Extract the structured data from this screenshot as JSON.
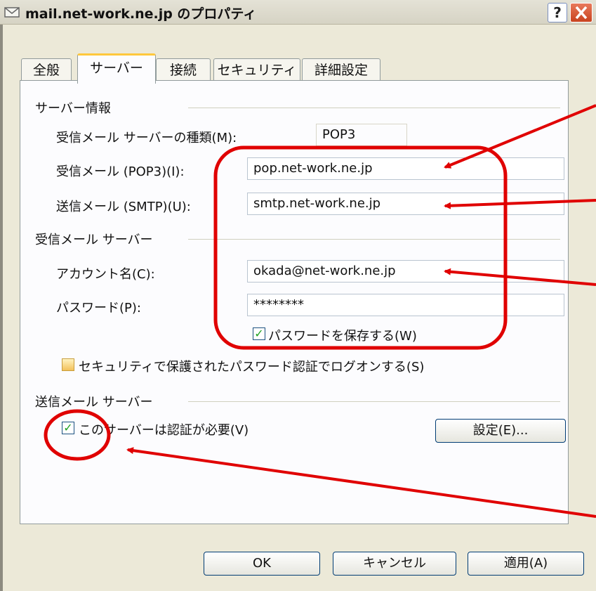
{
  "window": {
    "title": "mail.net-work.ne.jp のプロパティ",
    "help_label": "?",
    "close_label": "✕"
  },
  "tabs": [
    {
      "label": "全般"
    },
    {
      "label": "サーバー"
    },
    {
      "label": "接続"
    },
    {
      "label": "セキュリティ"
    },
    {
      "label": "詳細設定"
    }
  ],
  "server_info": {
    "heading": "サーバー情報",
    "type_label": "受信メール サーバーの種類(M):",
    "type_value": "POP3",
    "incoming_label": "受信メール (POP3)(I):",
    "incoming_value": "pop.net-work.ne.jp",
    "outgoing_label": "送信メール (SMTP)(U):",
    "outgoing_value": "smtp.net-work.ne.jp"
  },
  "incoming_server": {
    "heading": "受信メール サーバー",
    "account_label": "アカウント名(C):",
    "account_value": "okada@net-work.ne.jp",
    "password_label": "パスワード(P):",
    "password_value": "********",
    "save_password_label": "パスワードを保存する(W)",
    "save_password_checked": true,
    "spa_label": "セキュリティで保護されたパスワード認証でログオンする(S)",
    "spa_checked": false
  },
  "outgoing_server": {
    "heading": "送信メール サーバー",
    "auth_label": "このサーバーは認証が必要(V)",
    "auth_checked": true,
    "settings_button": "設定(E)..."
  },
  "footer": {
    "ok": "OK",
    "cancel": "キャンセル",
    "apply": "適用(A)"
  },
  "check_mark": "✓",
  "colors": {
    "annotation": "#e00000",
    "active_tab": "#ffc83c"
  }
}
